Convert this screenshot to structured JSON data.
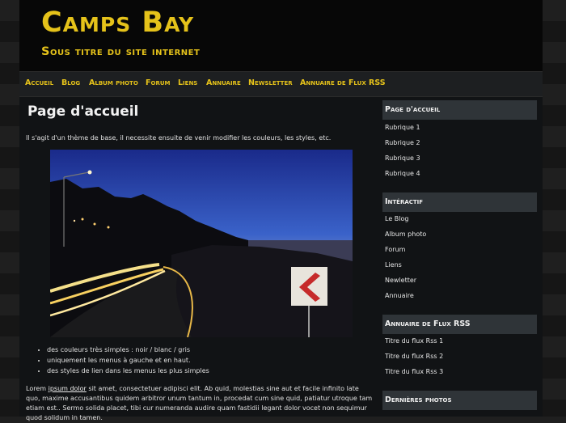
{
  "header": {
    "title": "Camps Bay",
    "subtitle": "Sous titre du site internet"
  },
  "nav": {
    "items": [
      {
        "label": "Accueil"
      },
      {
        "label": "Blog"
      },
      {
        "label": "Album photo"
      },
      {
        "label": "Forum"
      },
      {
        "label": "Liens"
      },
      {
        "label": "Annuaire"
      },
      {
        "label": "Newsletter"
      },
      {
        "label": "Annuaire de Flux RSS"
      }
    ]
  },
  "main": {
    "title": "Page d'accueil",
    "intro": "Il s'agit d'un thème de base, il necessite ensuite de venir modifier les couleurs, les styles, etc.",
    "bullets": [
      "des couleurs très simples : noir / blanc / gris",
      "uniquement les menus à gauche et en haut.",
      "des styles de lien dans les menus les plus simples"
    ],
    "lorem_start": "Lorem ",
    "lorem_link": "ipsum dolor",
    "lorem_rest": " sit amet, consectetuer adipisci elit. Ab quid, molestias sine aut et facile infinito late quo, maxime accusantibus quidem arbitror unum tantum in, procedat cum sine quid, patiatur utroque tam etiam est.. Sermo solida placet, tibi cur numeranda audire quam fastidii legant dolor vocet non sequimur quod solidum in tamen."
  },
  "sidebar": {
    "sections": [
      {
        "title": "Page d'accueil",
        "items": [
          "Rubrique 1",
          "Rubrique 2",
          "Rubrique 3",
          "Rubrique 4"
        ]
      },
      {
        "title": "Intéractif",
        "items": [
          "Le Blog",
          "Album photo",
          "Forum",
          "Liens",
          "Newletter",
          "Annuaire"
        ]
      },
      {
        "title": "Annuaire de Flux RSS",
        "items": [
          "Titre du flux Rss 1",
          "Titre du flux Rss 2",
          "Titre du flux Rss 3"
        ]
      },
      {
        "title": "Dernières photos",
        "items": []
      }
    ]
  },
  "colors": {
    "accent": "#e5c21a",
    "header_bg": "#070707",
    "page_bg": "#111315",
    "sidebar_head_bg": "#2f3438"
  }
}
